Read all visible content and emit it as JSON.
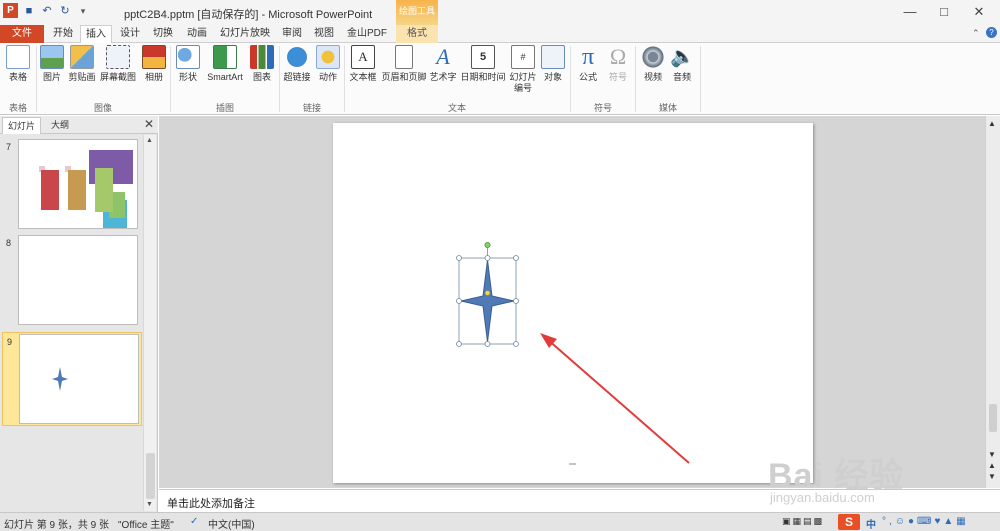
{
  "window": {
    "title": "pptC2B4.pptm [自动保存的] - Microsoft PowerPoint",
    "context_group": "绘图工具",
    "app_logo": "P"
  },
  "tabs": [
    {
      "label": "文件"
    },
    {
      "label": "开始"
    },
    {
      "label": "插入"
    },
    {
      "label": "设计"
    },
    {
      "label": "切换"
    },
    {
      "label": "动画"
    },
    {
      "label": "幻灯片放映"
    },
    {
      "label": "审阅"
    },
    {
      "label": "视图"
    },
    {
      "label": "金山PDF"
    },
    {
      "label": "格式"
    }
  ],
  "ribbon": {
    "buttons": {
      "table": "表格",
      "picture": "图片",
      "clipart": "剪贴画",
      "screenshot": "屏幕截图",
      "album": "相册",
      "shapes": "形状",
      "smartart": "SmartArt",
      "chart": "图表",
      "hyperlink": "超链接",
      "action": "动作",
      "textbox": "文本框",
      "header_footer": "页眉和页脚",
      "wordart": "艺术字",
      "datetime": "日期和时间",
      "slide_number": "幻灯片编号",
      "object": "对象",
      "equation": "公式",
      "symbol": "符号",
      "video": "视频",
      "audio": "音频"
    },
    "groups": {
      "tables": "表格",
      "images": "图像",
      "illustrations": "插图",
      "links": "链接",
      "text": "文本",
      "symbols": "符号",
      "media": "媒体"
    }
  },
  "left_pane": {
    "tab_slides": "幻灯片",
    "tab_outline": "大纲",
    "slides": [
      {
        "number": "7"
      },
      {
        "number": "8"
      },
      {
        "number": "9"
      }
    ]
  },
  "notes": {
    "placeholder": "单击此处添加备注"
  },
  "status": {
    "slide_info": "幻灯片 第 9 张，共 9 张",
    "theme": "\"Office 主题\"",
    "language": "中文(中国)",
    "ime": "中",
    "ime_logo": "S"
  },
  "watermark": {
    "brand": "Bai 经验",
    "url": "jingyan.baidu.com"
  },
  "colors": {
    "file_tab": "#d24726",
    "star_fill": "#4f7ab5",
    "arrow": "#e23b3b",
    "selected_slide": "#ffe79a"
  }
}
